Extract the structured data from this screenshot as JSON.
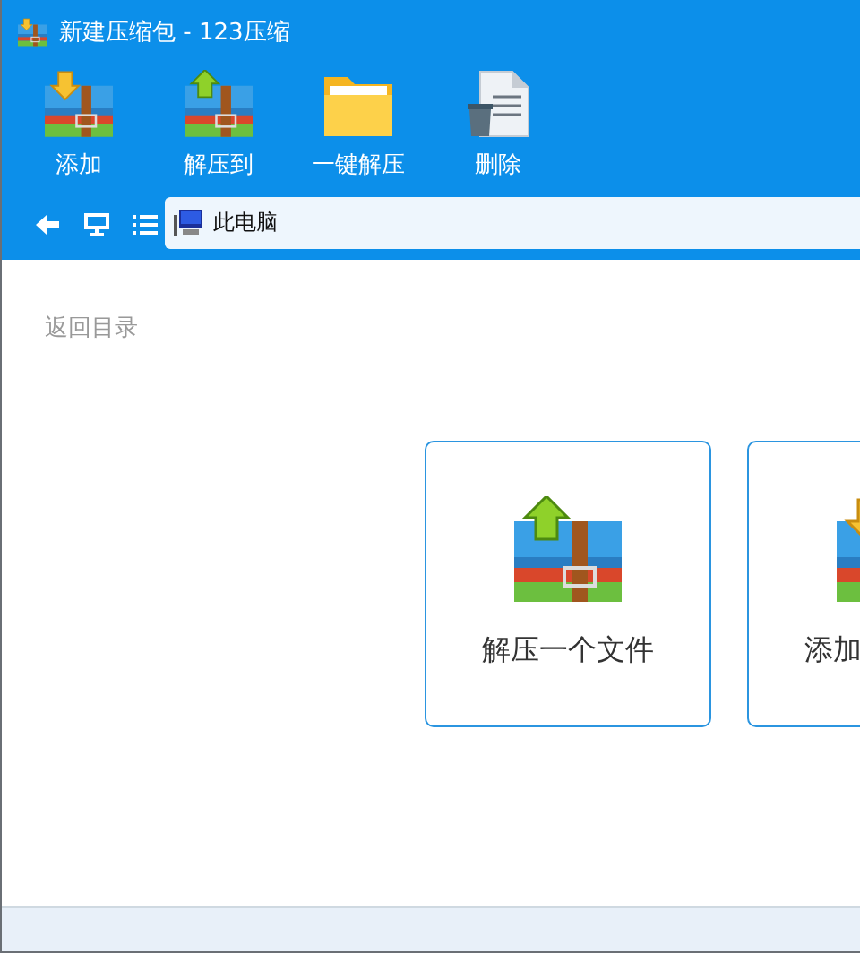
{
  "window": {
    "title": "新建压缩包 - 123压缩"
  },
  "toolbar": {
    "buttons": [
      {
        "label": "添加",
        "kind": "add"
      },
      {
        "label": "解压到",
        "kind": "extract"
      },
      {
        "label": "一键解压",
        "kind": "folder"
      },
      {
        "label": "删除",
        "kind": "delete"
      }
    ]
  },
  "nav": {
    "address": "此电脑"
  },
  "content": {
    "back_link": "返回目录",
    "cards": [
      {
        "label": "解压一个文件",
        "kind": "extract"
      },
      {
        "label": "添加",
        "kind": "add"
      }
    ]
  }
}
